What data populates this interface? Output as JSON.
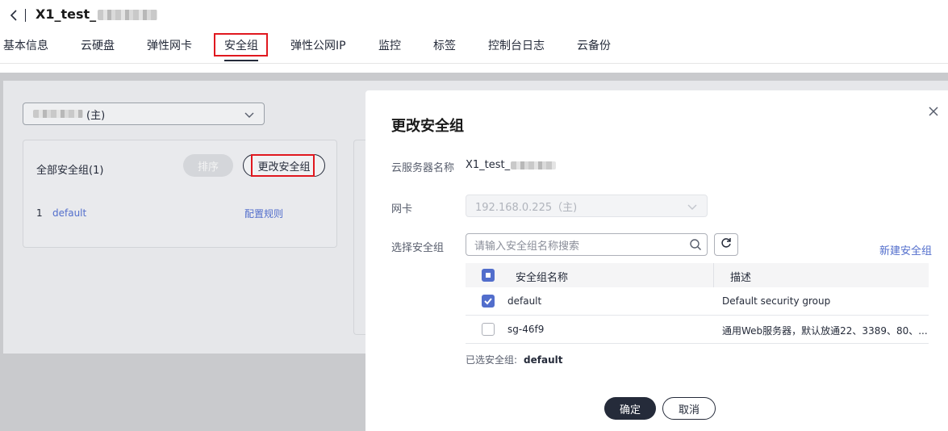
{
  "header": {
    "title_prefix": "X1_test_",
    "tabs": [
      {
        "label": "基本信息"
      },
      {
        "label": "云硬盘"
      },
      {
        "label": "弹性网卡"
      },
      {
        "label": "安全组"
      },
      {
        "label": "弹性公网IP"
      },
      {
        "label": "监控"
      },
      {
        "label": "标签"
      },
      {
        "label": "控制台日志"
      },
      {
        "label": "云备份"
      }
    ],
    "active_tab": "安全组"
  },
  "background": {
    "nic_select_suffix": "(主)",
    "sg_panel_title": "全部安全组(1)",
    "sort_button": "排序",
    "change_sg_button": "更改安全组",
    "rows": [
      {
        "index": "1",
        "name": "default",
        "action": "配置规则"
      }
    ]
  },
  "drawer": {
    "title": "更改安全组",
    "server_name_label": "云服务器名称",
    "server_name_prefix": "X1_test_",
    "nic_label": "网卡",
    "nic_value": "192.168.0.225（主)",
    "select_sg_label": "选择安全组",
    "search_placeholder": "请输入安全组名称搜索",
    "new_sg_link": "新建安全组",
    "table": {
      "columns": [
        "安全组名称",
        "描述"
      ],
      "rows": [
        {
          "name": "default",
          "desc": "Default security group",
          "checked": true
        },
        {
          "name": "sg-46f9",
          "desc": "通用Web服务器，默认放通22、3389、80、...",
          "checked": false
        }
      ]
    },
    "selected_label": "已选安全组:",
    "selected_value": "default",
    "ok_button": "确定",
    "cancel_button": "取消"
  },
  "colors": {
    "accent": "#526ecc",
    "primary_button": "#252b3a",
    "highlight_box": "#e0181f"
  }
}
